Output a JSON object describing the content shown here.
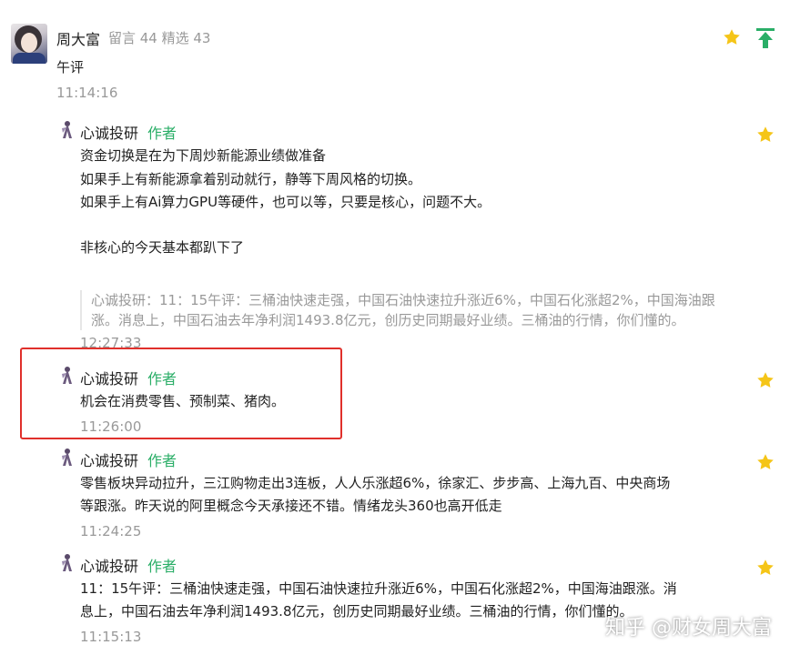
{
  "top_comment": {
    "user": "周大富",
    "stats": "留言 44 精选 43",
    "text": "午评",
    "time": "11:14:16"
  },
  "replies": [
    {
      "author": "心诚投研",
      "tag": "作者",
      "lines": [
        "资金切换是在为下周炒新能源业绩做准备",
        "如果手上有新能源拿着别动就行，静等下周风格的切换。",
        "如果手上有Ai算力GPU等硬件，也可以等，只要是核心，问题不大。",
        "",
        "非核心的今天基本都趴下了"
      ],
      "quote_lines": [
        "心诚投研：11：15午评：三桶油快速走强，中国石油快速拉升涨近6%，中国石化涨超2%，中国海油跟",
        "涨。消息上，中国石油去年净利润1493.8亿元，创历史同期最好业绩。三桶油的行情，你们懂的。"
      ],
      "time": "12:27:33"
    },
    {
      "author": "心诚投研",
      "tag": "作者",
      "lines": [
        "机会在消费零售、预制菜、猪肉。"
      ],
      "time": "11:26:00"
    },
    {
      "author": "心诚投研",
      "tag": "作者",
      "lines": [
        "零售板块异动拉升，三江购物走出3连板，人人乐涨超6%，徐家汇、步步高、上海九百、中央商场",
        "等跟涨。昨天说的阿里概念今天承接还不错。情绪龙头360也高开低走"
      ],
      "time": "11:24:25"
    },
    {
      "author": "心诚投研",
      "tag": "作者",
      "lines": [
        "11：15午评：三桶油快速走强，中国石油快速拉升涨近6%，中国石化涨超2%，中国海油跟涨。消",
        "息上，中国石油去年净利润1493.8亿元，创历史同期最好业绩。三桶油的行情，你们懂的。"
      ],
      "time": "11:15:13"
    }
  ],
  "watermark": "知乎 @财女周大富",
  "colors": {
    "accent_green": "#2aae67",
    "star_yellow": "#f5c518",
    "highlight_red": "#e0302b"
  },
  "icons": {
    "star": "star-icon",
    "upvote": "arrow-up-icon"
  }
}
